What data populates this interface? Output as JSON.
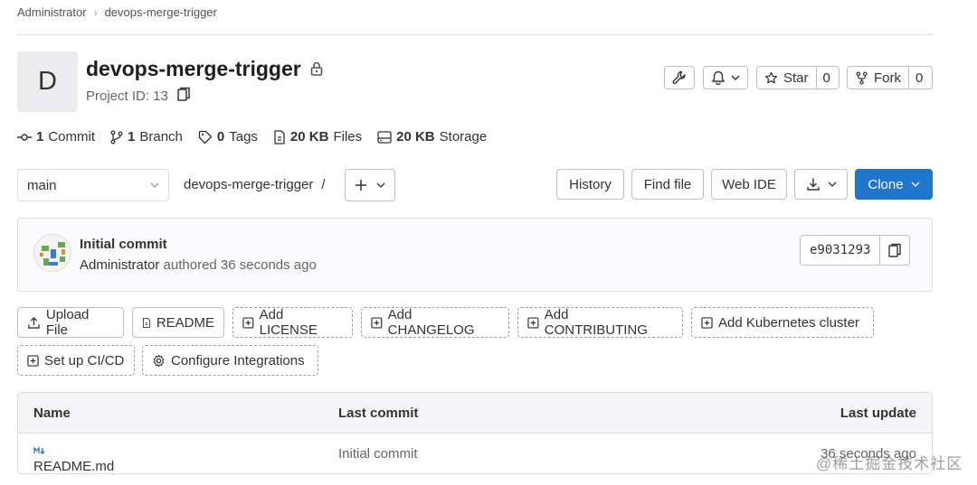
{
  "breadcrumb": {
    "parent": "Administrator",
    "current": "devops-merge-trigger"
  },
  "project": {
    "avatar_letter": "D",
    "name": "devops-merge-trigger",
    "id_text": "Project ID: 13"
  },
  "header_actions": {
    "star_label": "Star",
    "star_count": "0",
    "fork_label": "Fork",
    "fork_count": "0"
  },
  "stats": [
    {
      "value": "1",
      "label": "Commit"
    },
    {
      "value": "1",
      "label": "Branch"
    },
    {
      "value": "0",
      "label": "Tags"
    },
    {
      "value": "20 KB",
      "label": "Files"
    },
    {
      "value": "20 KB",
      "label": "Storage"
    }
  ],
  "toolbar": {
    "branch": "main",
    "path": "devops-merge-trigger",
    "path_sep": "/",
    "history": "History",
    "find_file": "Find file",
    "web_ide": "Web IDE",
    "clone": "Clone"
  },
  "commit": {
    "title": "Initial commit",
    "author": "Administrator",
    "meta": "authored 36 seconds ago",
    "sha": "e9031293"
  },
  "quick_actions": [
    "Upload File",
    "README",
    "Add LICENSE",
    "Add CHANGELOG",
    "Add CONTRIBUTING",
    "Add Kubernetes cluster",
    "Set up CI/CD",
    "Configure Integrations"
  ],
  "table": {
    "headers": {
      "name": "Name",
      "last_commit": "Last commit",
      "last_update": "Last update"
    },
    "rows": [
      {
        "name": "README.md",
        "last_commit": "Initial commit",
        "last_update": "36 seconds ago"
      }
    ]
  },
  "watermark": "@稀土掘金技术社区",
  "colors": {
    "primary": "#1f75cb",
    "border": "#bfbfc3"
  }
}
